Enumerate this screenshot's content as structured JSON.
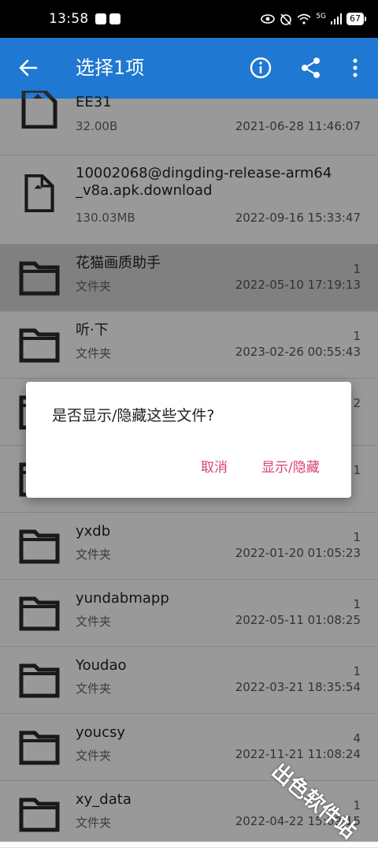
{
  "status_bar": {
    "time": "13:58",
    "network": "5G",
    "battery": "67"
  },
  "app_bar": {
    "title": "选择1项",
    "icons": [
      "back-arrow-icon",
      "info-icon",
      "share-icon",
      "more-vert-icon"
    ]
  },
  "files": [
    {
      "name": "EE31",
      "sub": "32.00B",
      "count": "",
      "date": "2021-06-28 11:46:07",
      "type": "file"
    },
    {
      "name": "10002068@dingding-release-arm64_v8a.apk.download",
      "name_line1": "10002068@dingding-release-arm64",
      "name_line2": "_v8a.apk.download",
      "sub": "130.03MB",
      "count": "",
      "date": "2022-09-16 15:33:47",
      "type": "file"
    },
    {
      "name": "花猫画质助手",
      "sub": "文件夹",
      "count": "1",
      "date": "2022-05-10 17:19:13",
      "type": "folder",
      "selected": true
    },
    {
      "name": "听·下",
      "sub": "文件夹",
      "count": "1",
      "date": "2023-02-26 00:55:43",
      "type": "folder"
    },
    {
      "name": "",
      "sub": "",
      "count": "2",
      "date": "",
      "type": "folder"
    },
    {
      "name": "",
      "sub": "",
      "count": "1",
      "date": "",
      "type": "folder"
    },
    {
      "name": "yxdb",
      "sub": "文件夹",
      "count": "1",
      "date": "2022-01-20 01:05:23",
      "type": "folder"
    },
    {
      "name": "yundabmapp",
      "sub": "文件夹",
      "count": "1",
      "date": "2022-05-11 01:08:25",
      "type": "folder"
    },
    {
      "name": "Youdao",
      "sub": "文件夹",
      "count": "1",
      "date": "2022-03-21 18:35:54",
      "type": "folder"
    },
    {
      "name": "youcsy",
      "sub": "文件夹",
      "count": "4",
      "date": "2022-11-21 11:08:24",
      "type": "folder"
    },
    {
      "name": "xy_data",
      "sub": "文件夹",
      "count": "1",
      "date": "2022-04-22 15:09:15",
      "type": "folder"
    }
  ],
  "dialog": {
    "message": "是否显示/隐藏这些文件?",
    "cancel_label": "取消",
    "confirm_label": "显示/隐藏"
  },
  "watermark": "出色软件站",
  "colors": {
    "app_bar": "#1f78d1",
    "dialog_button": "#d8407a"
  }
}
